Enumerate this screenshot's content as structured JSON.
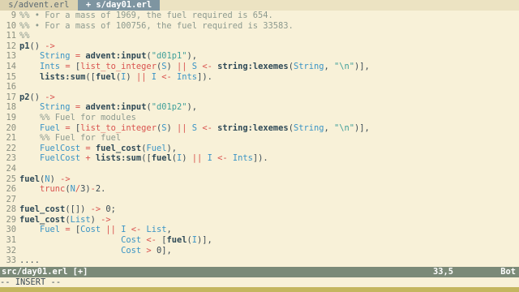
{
  "tabs": [
    {
      "label": " s/advent.erl ",
      "active": false
    },
    {
      "label": " + s/day01.erl ",
      "active": true
    }
  ],
  "lines": [
    {
      "n": "9",
      "parts": [
        [
          "comment",
          "%% • For a mass of 1969, the fuel required is 654."
        ]
      ]
    },
    {
      "n": "10",
      "parts": [
        [
          "comment",
          "%% • For a mass of 100756, the fuel required is 33583."
        ]
      ]
    },
    {
      "n": "11",
      "parts": [
        [
          "comment",
          "%%"
        ]
      ]
    },
    {
      "n": "12",
      "parts": [
        [
          "fn",
          "p1"
        ],
        [
          "plain",
          "() "
        ],
        [
          "op",
          "->"
        ]
      ]
    },
    {
      "n": "13",
      "parts": [
        [
          "plain",
          "    "
        ],
        [
          "var",
          "String"
        ],
        [
          "plain",
          " "
        ],
        [
          "op",
          "="
        ],
        [
          "plain",
          " "
        ],
        [
          "fn",
          "advent:input"
        ],
        [
          "plain",
          "("
        ],
        [
          "str",
          "\"d01p1\""
        ],
        [
          "plain",
          "),"
        ]
      ]
    },
    {
      "n": "14",
      "parts": [
        [
          "plain",
          "    "
        ],
        [
          "var",
          "Ints"
        ],
        [
          "plain",
          " "
        ],
        [
          "op",
          "="
        ],
        [
          "plain",
          " ["
        ],
        [
          "op",
          "list_to_integer"
        ],
        [
          "plain",
          "("
        ],
        [
          "var",
          "S"
        ],
        [
          "plain",
          ") "
        ],
        [
          "op",
          "||"
        ],
        [
          "plain",
          " "
        ],
        [
          "var",
          "S"
        ],
        [
          "plain",
          " "
        ],
        [
          "op",
          "<-"
        ],
        [
          "plain",
          " "
        ],
        [
          "fn",
          "string:lexemes"
        ],
        [
          "plain",
          "("
        ],
        [
          "var",
          "String"
        ],
        [
          "plain",
          ", "
        ],
        [
          "str",
          "\"\\n\""
        ],
        [
          "plain",
          ")],"
        ]
      ]
    },
    {
      "n": "15",
      "parts": [
        [
          "plain",
          "    "
        ],
        [
          "fn",
          "lists:sum"
        ],
        [
          "plain",
          "(["
        ],
        [
          "fn",
          "fuel"
        ],
        [
          "plain",
          "("
        ],
        [
          "var",
          "I"
        ],
        [
          "plain",
          ") "
        ],
        [
          "op",
          "||"
        ],
        [
          "plain",
          " "
        ],
        [
          "var",
          "I"
        ],
        [
          "plain",
          " "
        ],
        [
          "op",
          "<-"
        ],
        [
          "plain",
          " "
        ],
        [
          "var",
          "Ints"
        ],
        [
          "plain",
          "])."
        ]
      ]
    },
    {
      "n": "16",
      "parts": []
    },
    {
      "n": "17",
      "parts": [
        [
          "fn",
          "p2"
        ],
        [
          "plain",
          "() "
        ],
        [
          "op",
          "->"
        ]
      ]
    },
    {
      "n": "18",
      "parts": [
        [
          "plain",
          "    "
        ],
        [
          "var",
          "String"
        ],
        [
          "plain",
          " "
        ],
        [
          "op",
          "="
        ],
        [
          "plain",
          " "
        ],
        [
          "fn",
          "advent:input"
        ],
        [
          "plain",
          "("
        ],
        [
          "str",
          "\"d01p2\""
        ],
        [
          "plain",
          "),"
        ]
      ]
    },
    {
      "n": "19",
      "parts": [
        [
          "plain",
          "    "
        ],
        [
          "comment",
          "%% Fuel for modules"
        ]
      ]
    },
    {
      "n": "20",
      "parts": [
        [
          "plain",
          "    "
        ],
        [
          "var",
          "Fuel"
        ],
        [
          "plain",
          " "
        ],
        [
          "op",
          "="
        ],
        [
          "plain",
          " ["
        ],
        [
          "op",
          "list_to_integer"
        ],
        [
          "plain",
          "("
        ],
        [
          "var",
          "S"
        ],
        [
          "plain",
          ") "
        ],
        [
          "op",
          "||"
        ],
        [
          "plain",
          " "
        ],
        [
          "var",
          "S"
        ],
        [
          "plain",
          " "
        ],
        [
          "op",
          "<-"
        ],
        [
          "plain",
          " "
        ],
        [
          "fn",
          "string:lexemes"
        ],
        [
          "plain",
          "("
        ],
        [
          "var",
          "String"
        ],
        [
          "plain",
          ", "
        ],
        [
          "str",
          "\"\\n\""
        ],
        [
          "plain",
          ")],"
        ]
      ]
    },
    {
      "n": "21",
      "parts": [
        [
          "plain",
          "    "
        ],
        [
          "comment",
          "%% Fuel for fuel"
        ]
      ]
    },
    {
      "n": "22",
      "parts": [
        [
          "plain",
          "    "
        ],
        [
          "var",
          "FuelCost"
        ],
        [
          "plain",
          " "
        ],
        [
          "op",
          "="
        ],
        [
          "plain",
          " "
        ],
        [
          "fn",
          "fuel_cost"
        ],
        [
          "plain",
          "("
        ],
        [
          "var",
          "Fuel"
        ],
        [
          "plain",
          "),"
        ]
      ]
    },
    {
      "n": "23",
      "parts": [
        [
          "plain",
          "    "
        ],
        [
          "var",
          "FuelCost"
        ],
        [
          "plain",
          " "
        ],
        [
          "op",
          "+"
        ],
        [
          "plain",
          " "
        ],
        [
          "fn",
          "lists:sum"
        ],
        [
          "plain",
          "(["
        ],
        [
          "fn",
          "fuel"
        ],
        [
          "plain",
          "("
        ],
        [
          "var",
          "I"
        ],
        [
          "plain",
          ") "
        ],
        [
          "op",
          "||"
        ],
        [
          "plain",
          " "
        ],
        [
          "var",
          "I"
        ],
        [
          "plain",
          " "
        ],
        [
          "op",
          "<-"
        ],
        [
          "plain",
          " "
        ],
        [
          "var",
          "Ints"
        ],
        [
          "plain",
          "])."
        ]
      ]
    },
    {
      "n": "24",
      "parts": []
    },
    {
      "n": "25",
      "parts": [
        [
          "fn",
          "fuel"
        ],
        [
          "plain",
          "("
        ],
        [
          "var",
          "N"
        ],
        [
          "plain",
          ") "
        ],
        [
          "op",
          "->"
        ]
      ]
    },
    {
      "n": "26",
      "parts": [
        [
          "plain",
          "    "
        ],
        [
          "op",
          "trunc"
        ],
        [
          "plain",
          "("
        ],
        [
          "var",
          "N"
        ],
        [
          "op",
          "/"
        ],
        [
          "plain",
          "3)"
        ],
        [
          "op",
          "-"
        ],
        [
          "plain",
          "2."
        ]
      ]
    },
    {
      "n": "27",
      "parts": []
    },
    {
      "n": "28",
      "parts": [
        [
          "fn",
          "fuel_cost"
        ],
        [
          "plain",
          "([]) "
        ],
        [
          "op",
          "->"
        ],
        [
          "plain",
          " 0;"
        ]
      ]
    },
    {
      "n": "29",
      "parts": [
        [
          "fn",
          "fuel_cost"
        ],
        [
          "plain",
          "("
        ],
        [
          "var",
          "List"
        ],
        [
          "plain",
          ") "
        ],
        [
          "op",
          "->"
        ]
      ]
    },
    {
      "n": "30",
      "parts": [
        [
          "plain",
          "    "
        ],
        [
          "var",
          "Fuel"
        ],
        [
          "plain",
          " "
        ],
        [
          "op",
          "="
        ],
        [
          "plain",
          " ["
        ],
        [
          "var",
          "Cost"
        ],
        [
          "plain",
          " "
        ],
        [
          "op",
          "||"
        ],
        [
          "plain",
          " "
        ],
        [
          "var",
          "I"
        ],
        [
          "plain",
          " "
        ],
        [
          "op",
          "<-"
        ],
        [
          "plain",
          " "
        ],
        [
          "var",
          "List"
        ],
        [
          "plain",
          ","
        ]
      ]
    },
    {
      "n": "31",
      "parts": [
        [
          "plain",
          "                    "
        ],
        [
          "var",
          "Cost"
        ],
        [
          "plain",
          " "
        ],
        [
          "op",
          "<-"
        ],
        [
          "plain",
          " ["
        ],
        [
          "fn",
          "fuel"
        ],
        [
          "plain",
          "("
        ],
        [
          "var",
          "I"
        ],
        [
          "plain",
          ")],"
        ]
      ]
    },
    {
      "n": "32",
      "parts": [
        [
          "plain",
          "                    "
        ],
        [
          "var",
          "Cost"
        ],
        [
          "plain",
          " "
        ],
        [
          "op",
          ">"
        ],
        [
          "plain",
          " 0],"
        ]
      ]
    },
    {
      "n": "33",
      "parts": [
        [
          "plain",
          "...."
        ]
      ]
    }
  ],
  "status": {
    "file": "src/day01.erl [+]",
    "position": "33,5",
    "scroll": "Bot"
  },
  "cmdline": "-- INSERT --",
  "colors": {
    "tabline_bg": "#ece3c2",
    "active_tab_bg": "#7e95a1",
    "statusline_bg": "#7b8a78",
    "tmux_bar": "#c4b65f",
    "background": "#f8f1d8"
  }
}
